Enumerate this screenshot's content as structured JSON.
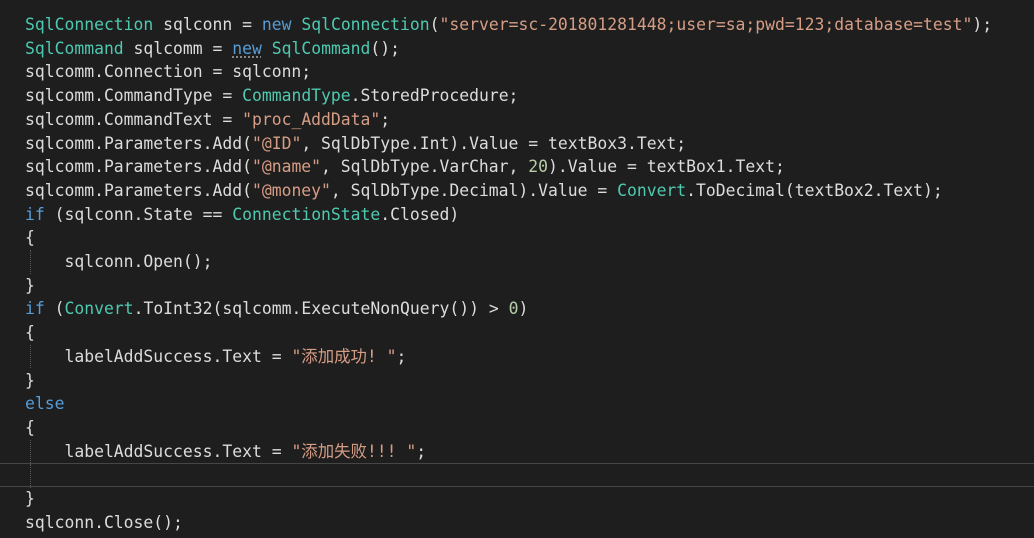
{
  "colors": {
    "background": "#1e1e1e",
    "plain": "#dcdcdc",
    "keyword": "#569cd6",
    "type": "#4ec9b0",
    "string": "#d69d85",
    "number": "#b5cea8",
    "current_line_border": "#464646"
  },
  "current_line": 19,
  "code_lines": [
    [
      [
        "ty",
        "SqlConnection"
      ],
      [
        "p",
        " sqlconn = "
      ],
      [
        "kw",
        "new"
      ],
      [
        "p",
        " "
      ],
      [
        "ty",
        "SqlConnection"
      ],
      [
        "p",
        "("
      ],
      [
        "str",
        "\"server=sc-201801281448;user=sa;pwd=123;database=test\""
      ],
      [
        "p",
        ");"
      ]
    ],
    [
      [
        "ty",
        "SqlCommand"
      ],
      [
        "p",
        " sqlcomm = "
      ],
      [
        "kw squig",
        "new"
      ],
      [
        "p",
        " "
      ],
      [
        "ty",
        "SqlCommand"
      ],
      [
        "p",
        "();"
      ]
    ],
    [
      [
        "p",
        "sqlcomm.Connection = sqlconn;"
      ]
    ],
    [
      [
        "p",
        "sqlcomm.CommandType = "
      ],
      [
        "ty",
        "CommandType"
      ],
      [
        "p",
        ".StoredProcedure;"
      ]
    ],
    [
      [
        "p",
        "sqlcomm.CommandText = "
      ],
      [
        "str",
        "\"proc_AddData\""
      ],
      [
        "p",
        ";"
      ]
    ],
    [
      [
        "p",
        "sqlcomm.Parameters.Add("
      ],
      [
        "str",
        "\"@ID\""
      ],
      [
        "p",
        ", SqlDbType.Int).Value = textBox3.Text;"
      ]
    ],
    [
      [
        "p",
        "sqlcomm.Parameters.Add("
      ],
      [
        "str",
        "\"@name\""
      ],
      [
        "p",
        ", SqlDbType.VarChar, "
      ],
      [
        "num",
        "20"
      ],
      [
        "p",
        ").Value = textBox1.Text;"
      ]
    ],
    [
      [
        "p",
        "sqlcomm.Parameters.Add("
      ],
      [
        "str",
        "\"@money\""
      ],
      [
        "p",
        ", SqlDbType.Decimal).Value = "
      ],
      [
        "ty",
        "Convert"
      ],
      [
        "p",
        ".ToDecimal(textBox2.Text);"
      ]
    ],
    [
      [
        "kw",
        "if"
      ],
      [
        "p",
        " (sqlconn.State == "
      ],
      [
        "ty",
        "ConnectionState"
      ],
      [
        "p",
        ".Closed)"
      ]
    ],
    [
      [
        "p",
        "{"
      ]
    ],
    [
      [
        "p",
        "    sqlconn.Open();"
      ]
    ],
    [
      [
        "p",
        "}"
      ]
    ],
    [
      [
        "kw",
        "if"
      ],
      [
        "p",
        " ("
      ],
      [
        "ty",
        "Convert"
      ],
      [
        "p",
        ".ToInt32(sqlcomm.ExecuteNonQuery()) > "
      ],
      [
        "num",
        "0"
      ],
      [
        "p",
        ")"
      ]
    ],
    [
      [
        "p",
        "{"
      ]
    ],
    [
      [
        "p",
        "    labelAddSuccess.Text = "
      ],
      [
        "str",
        "\"添加成功! \""
      ],
      [
        "p",
        ";"
      ]
    ],
    [
      [
        "p",
        "}"
      ]
    ],
    [
      [
        "kw",
        "else"
      ]
    ],
    [
      [
        "p",
        "{"
      ]
    ],
    [
      [
        "p",
        "    labelAddSuccess.Text = "
      ],
      [
        "str",
        "\"添加失败!!! \""
      ],
      [
        "p",
        ";"
      ]
    ],
    [
      [
        "p",
        ""
      ]
    ],
    [
      [
        "p",
        "}"
      ]
    ],
    [
      [
        "p",
        "sqlconn.Close();"
      ]
    ]
  ]
}
